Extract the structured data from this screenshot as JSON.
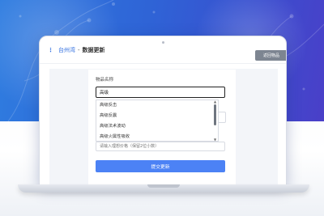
{
  "header": {
    "menu_icon": "more-vertical-icon",
    "breadcrumb_link": "台州湾",
    "breadcrumb_separator": "-",
    "breadcrumb_current": "数据更新",
    "back_button": "返回物品"
  },
  "form": {
    "item_name_label": "物品名称",
    "item_name_value": "高级",
    "suggestions": [
      "高级反击",
      "高级反震",
      "高级法术波动",
      "高级火属性吸收"
    ],
    "price_placeholder": "请输入理想价格（保留2位小数）",
    "submit_label": "提交更新"
  },
  "colors": {
    "primary": "#2d6cdf",
    "submit": "#4c82f5",
    "back_button": "#7d8591"
  }
}
